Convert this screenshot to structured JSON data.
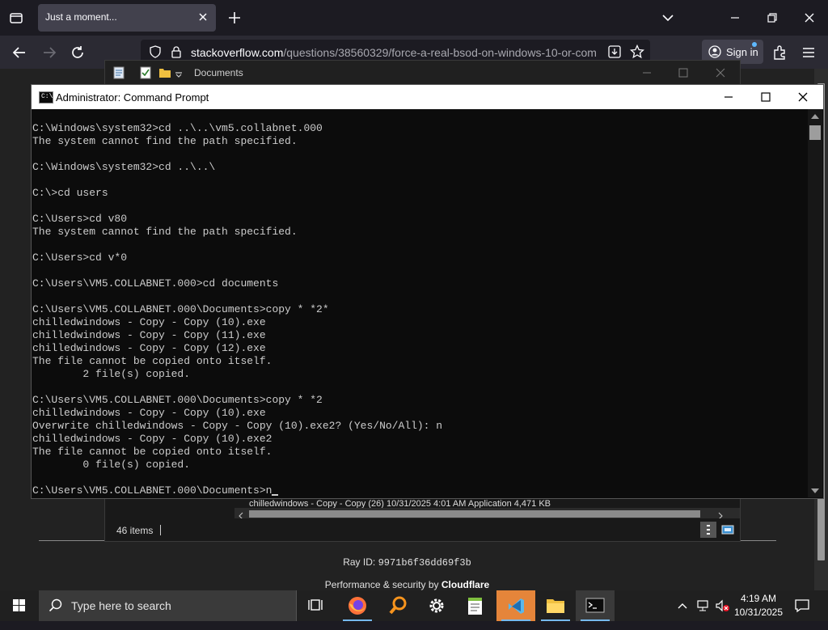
{
  "browser": {
    "tab_title": "Just a moment...",
    "url_domain": "stackoverflow.com",
    "url_path": "/questions/38560329/force-a-real-bsod-on-windows-10-or-com",
    "sign_in_label": "Sign in"
  },
  "page": {
    "ray_label": "Ray ID:",
    "ray_id": "9971b6f36dd69f3b",
    "perf_prefix": "Performance & security by",
    "perf_brand": "Cloudflare"
  },
  "explorer": {
    "title": "Documents",
    "item_count": "46 items",
    "partial_row": "chilledwindows - Copy - Copy (26)          10/31/2025 4:01 AM          Application          4,471 KB"
  },
  "cmd": {
    "title": "Administrator: Command Prompt",
    "lines": [
      "C:\\Windows\\system32>cd ..\\..\\vm5.collabnet.000",
      "The system cannot find the path specified.",
      "",
      "C:\\Windows\\system32>cd ..\\..\\",
      "",
      "C:\\>cd users",
      "",
      "C:\\Users>cd v80",
      "The system cannot find the path specified.",
      "",
      "C:\\Users>cd v*0",
      "",
      "C:\\Users\\VM5.COLLABNET.000>cd documents",
      "",
      "C:\\Users\\VM5.COLLABNET.000\\Documents>copy * *2*",
      "chilledwindows - Copy - Copy (10).exe",
      "chilledwindows - Copy - Copy (11).exe",
      "chilledwindows - Copy - Copy (12).exe",
      "The file cannot be copied onto itself.",
      "        2 file(s) copied.",
      "",
      "C:\\Users\\VM5.COLLABNET.000\\Documents>copy * *2",
      "chilledwindows - Copy - Copy (10).exe",
      "Overwrite chilledwindows - Copy - Copy (10).exe2? (Yes/No/All): n",
      "chilledwindows - Copy - Copy (10).exe2",
      "The file cannot be copied onto itself.",
      "        0 file(s) copied.",
      "",
      "C:\\Users\\VM5.COLLABNET.000\\Documents>n"
    ]
  },
  "taskbar": {
    "search_placeholder": "Type here to search",
    "apps": [
      "task-view-icon",
      "firefox-icon",
      "search-app-icon",
      "settings-icon",
      "notepad-icon",
      "visual-studio-icon",
      "file-explorer-icon",
      "command-prompt-icon"
    ],
    "time": "4:19 AM",
    "date": "10/31/2025"
  },
  "colors": {
    "accent": "#76b9ed",
    "console_bg": "#0c0c0c",
    "console_fg": "#cccccc"
  }
}
